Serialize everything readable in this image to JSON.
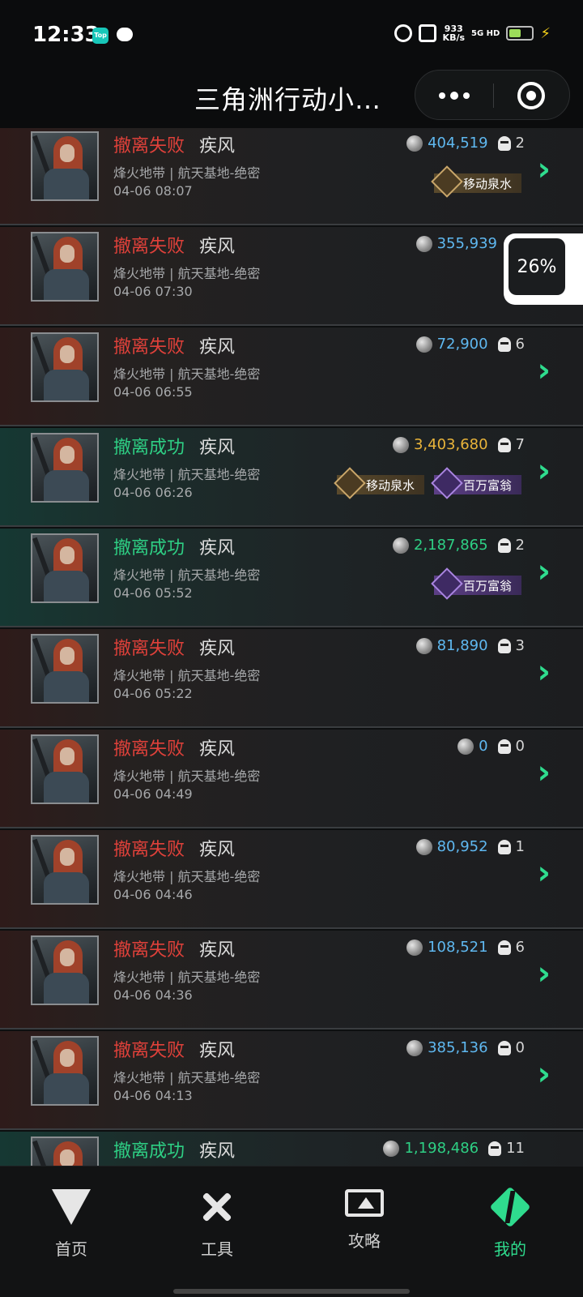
{
  "status_bar": {
    "time": "12:33",
    "app_badge": "Top",
    "net_speed": "933",
    "net_unit": "KB/s",
    "network": "5G HD"
  },
  "title_bar": {
    "title": "三角洲行动小…"
  },
  "floating": {
    "progress": "26%"
  },
  "records": [
    {
      "result": "撤离失败",
      "result_type": "fail",
      "operator": "疾风",
      "map": "烽火地带 | 航天基地-绝密",
      "time": "04-06 08:07",
      "value": "404,519",
      "value_color": "blue",
      "kills": "2",
      "badges": [
        "移动泉水"
      ]
    },
    {
      "result": "撤离失败",
      "result_type": "fail",
      "operator": "疾风",
      "map": "烽火地带 | 航天基地-绝密",
      "time": "04-06 07:30",
      "value": "355,939",
      "value_color": "blue",
      "kills": "",
      "badges": []
    },
    {
      "result": "撤离失败",
      "result_type": "fail",
      "operator": "疾风",
      "map": "烽火地带 | 航天基地-绝密",
      "time": "04-06 06:55",
      "value": "72,900",
      "value_color": "blue",
      "kills": "6",
      "badges": []
    },
    {
      "result": "撤离成功",
      "result_type": "success",
      "operator": "疾风",
      "map": "烽火地带 | 航天基地-绝密",
      "time": "04-06 06:26",
      "value": "3,403,680",
      "value_color": "gold",
      "kills": "7",
      "badges": [
        "移动泉水",
        "百万富翁"
      ]
    },
    {
      "result": "撤离成功",
      "result_type": "success",
      "operator": "疾风",
      "map": "烽火地带 | 航天基地-绝密",
      "time": "04-06 05:52",
      "value": "2,187,865",
      "value_color": "green",
      "kills": "2",
      "badges": [
        "百万富翁"
      ]
    },
    {
      "result": "撤离失败",
      "result_type": "fail",
      "operator": "疾风",
      "map": "烽火地带 | 航天基地-绝密",
      "time": "04-06 05:22",
      "value": "81,890",
      "value_color": "blue",
      "kills": "3",
      "badges": []
    },
    {
      "result": "撤离失败",
      "result_type": "fail",
      "operator": "疾风",
      "map": "烽火地带 | 航天基地-绝密",
      "time": "04-06 04:49",
      "value": "0",
      "value_color": "blue",
      "kills": "0",
      "badges": []
    },
    {
      "result": "撤离失败",
      "result_type": "fail",
      "operator": "疾风",
      "map": "烽火地带 | 航天基地-绝密",
      "time": "04-06 04:46",
      "value": "80,952",
      "value_color": "blue",
      "kills": "1",
      "badges": []
    },
    {
      "result": "撤离失败",
      "result_type": "fail",
      "operator": "疾风",
      "map": "烽火地带 | 航天基地-绝密",
      "time": "04-06 04:36",
      "value": "108,521",
      "value_color": "blue",
      "kills": "6",
      "badges": []
    },
    {
      "result": "撤离失败",
      "result_type": "fail",
      "operator": "疾风",
      "map": "烽火地带 | 航天基地-绝密",
      "time": "04-06 04:13",
      "value": "385,136",
      "value_color": "blue",
      "kills": "0",
      "badges": []
    },
    {
      "result": "撤离成功",
      "result_type": "success",
      "operator": "疾风",
      "map": "",
      "time": "",
      "value": "1,198,486",
      "value_color": "green",
      "kills": "11",
      "badges": []
    }
  ],
  "tabs": [
    {
      "label": "首页",
      "icon": "home-logo-icon",
      "active": false
    },
    {
      "label": "工具",
      "icon": "tools-icon",
      "active": false
    },
    {
      "label": "攻略",
      "icon": "guide-icon",
      "active": false
    },
    {
      "label": "我的",
      "icon": "mine-logo-icon",
      "active": true
    }
  ]
}
